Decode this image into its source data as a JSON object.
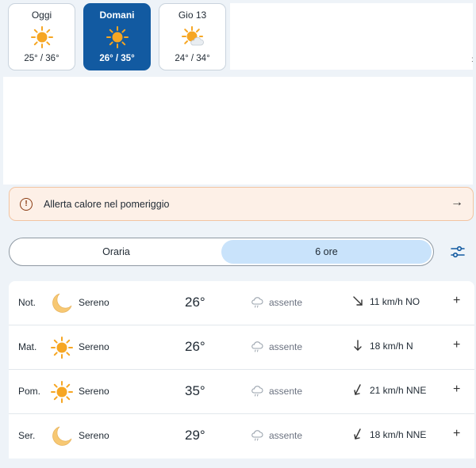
{
  "days": [
    {
      "name": "Oggi",
      "temps": "25° / 36°",
      "icon": "sun-icon",
      "active": false
    },
    {
      "name": "Domani",
      "temps": "26° / 35°",
      "icon": "sun-icon",
      "active": true
    },
    {
      "name": "Gio 13",
      "temps": "24° / 34°",
      "icon": "sun-cloud-icon",
      "active": false
    }
  ],
  "alert": {
    "icon": "alert-circle-icon",
    "text": "Allerta calore nel pomeriggio",
    "arrow": "→"
  },
  "tabs": [
    {
      "label": "Oraria",
      "active": false
    },
    {
      "label": "6 ore",
      "active": true
    }
  ],
  "filter_icon": "sliders-icon",
  "rows": [
    {
      "period": "Not.",
      "icon": "moon-icon",
      "condition": "Sereno",
      "temp": "26°",
      "rain_icon": "cloud-rain-icon",
      "rain": "assente",
      "wind_dir": "NO",
      "wind": "11 km/h NO",
      "plus": "+"
    },
    {
      "period": "Mat.",
      "icon": "sun-icon",
      "condition": "Sereno",
      "temp": "26°",
      "rain_icon": "cloud-rain-icon",
      "rain": "assente",
      "wind_dir": "N",
      "wind": "18 km/h N",
      "plus": "+"
    },
    {
      "period": "Pom.",
      "icon": "sun-icon",
      "condition": "Sereno",
      "temp": "35°",
      "rain_icon": "cloud-rain-icon",
      "rain": "assente",
      "wind_dir": "NNE",
      "wind": "21 km/h NNE",
      "plus": "+"
    },
    {
      "period": "Ser.",
      "icon": "moon-icon",
      "condition": "Sereno",
      "temp": "29°",
      "rain_icon": "cloud-rain-icon",
      "rain": "assente",
      "wind_dir": "NNE",
      "wind": "18 km/h NNE",
      "plus": "+"
    }
  ],
  "colors": {
    "accent": "#125aa1",
    "active_tab": "#c9e3fb",
    "alert_bg": "#fdf0e7",
    "sun": "#f6a623"
  }
}
